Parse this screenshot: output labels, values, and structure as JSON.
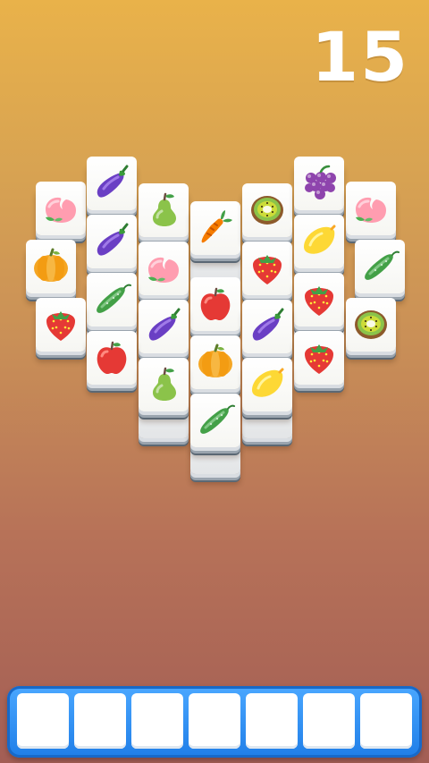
{
  "hud": {
    "remaining_count": "15"
  },
  "tray": {
    "slot_count": 7,
    "filled": []
  },
  "colors": {
    "tray_blue": "#1f7ee8",
    "tile_face": "#ffffff"
  },
  "tiles": [
    {
      "icon": "peach",
      "layer": "top"
    },
    {
      "icon": "eggplant",
      "layer": "top"
    },
    {
      "icon": "pear",
      "layer": "top"
    },
    {
      "icon": "carrot",
      "layer": "top"
    },
    {
      "icon": "kiwi",
      "layer": "top"
    },
    {
      "icon": "grapes",
      "layer": "top"
    },
    {
      "icon": "peach",
      "layer": "top"
    },
    {
      "icon": "pumpkin",
      "layer": "top"
    },
    {
      "icon": "eggplant",
      "layer": "top"
    },
    {
      "icon": "peach",
      "layer": "top"
    },
    {
      "icon": "strawberry",
      "layer": "top"
    },
    {
      "icon": "lemon",
      "layer": "top"
    },
    {
      "icon": "cucumber",
      "layer": "top"
    },
    {
      "icon": "cucumber",
      "layer": "top"
    },
    {
      "icon": "apple",
      "layer": "top"
    },
    {
      "icon": "strawberry",
      "layer": "top"
    },
    {
      "icon": "strawberry",
      "layer": "top"
    },
    {
      "icon": "eggplant",
      "layer": "top"
    },
    {
      "icon": "eggplant",
      "layer": "top"
    },
    {
      "icon": "kiwi",
      "layer": "top"
    },
    {
      "icon": "apple",
      "layer": "top"
    },
    {
      "icon": "pumpkin",
      "layer": "top"
    },
    {
      "icon": "strawberry",
      "layer": "top"
    },
    {
      "icon": "pear",
      "layer": "top"
    },
    {
      "icon": "lemon",
      "layer": "top"
    },
    {
      "icon": "cucumber",
      "layer": "top"
    }
  ]
}
